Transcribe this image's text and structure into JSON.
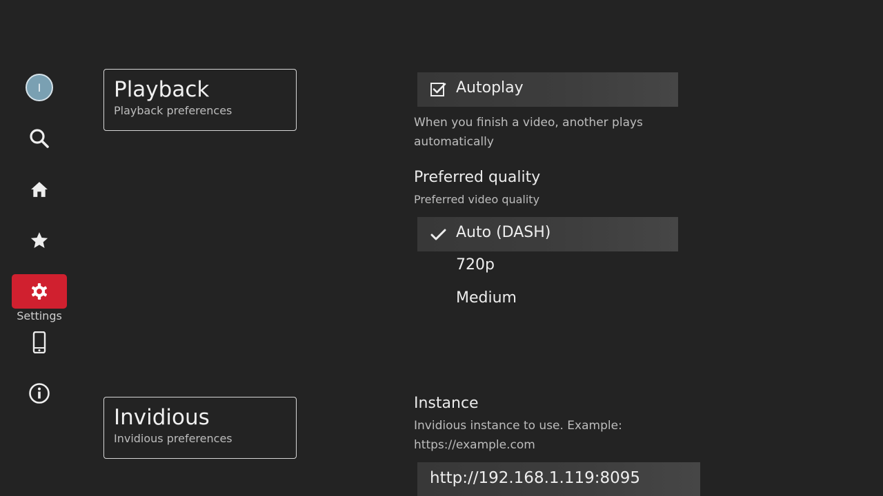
{
  "sidebar": {
    "avatar_letter": "I",
    "selected_caption": "Settings"
  },
  "sections": {
    "playback": {
      "title": "Playback",
      "subtitle": "Playback preferences"
    },
    "invidious": {
      "title": "Invidious",
      "subtitle": "Invidious preferences"
    }
  },
  "playback": {
    "autoplay": {
      "label": "Autoplay",
      "checked": true,
      "help_line1": "When you finish a video, another plays",
      "help_line2": "automatically"
    },
    "quality": {
      "title": "Preferred quality",
      "subtitle": "Preferred video quality",
      "options": [
        "Auto (DASH)",
        "720p",
        "Medium"
      ],
      "selected": "Auto (DASH)"
    }
  },
  "invidious": {
    "instance": {
      "title": "Instance",
      "help_line1": "Invidious instance to use. Example:",
      "help_line2": "https://example.com",
      "value": "http://192.168.1.119:8095"
    }
  },
  "colors": {
    "background": "#232323",
    "accent": "#d0202f",
    "avatar": "#7aa0b2"
  }
}
